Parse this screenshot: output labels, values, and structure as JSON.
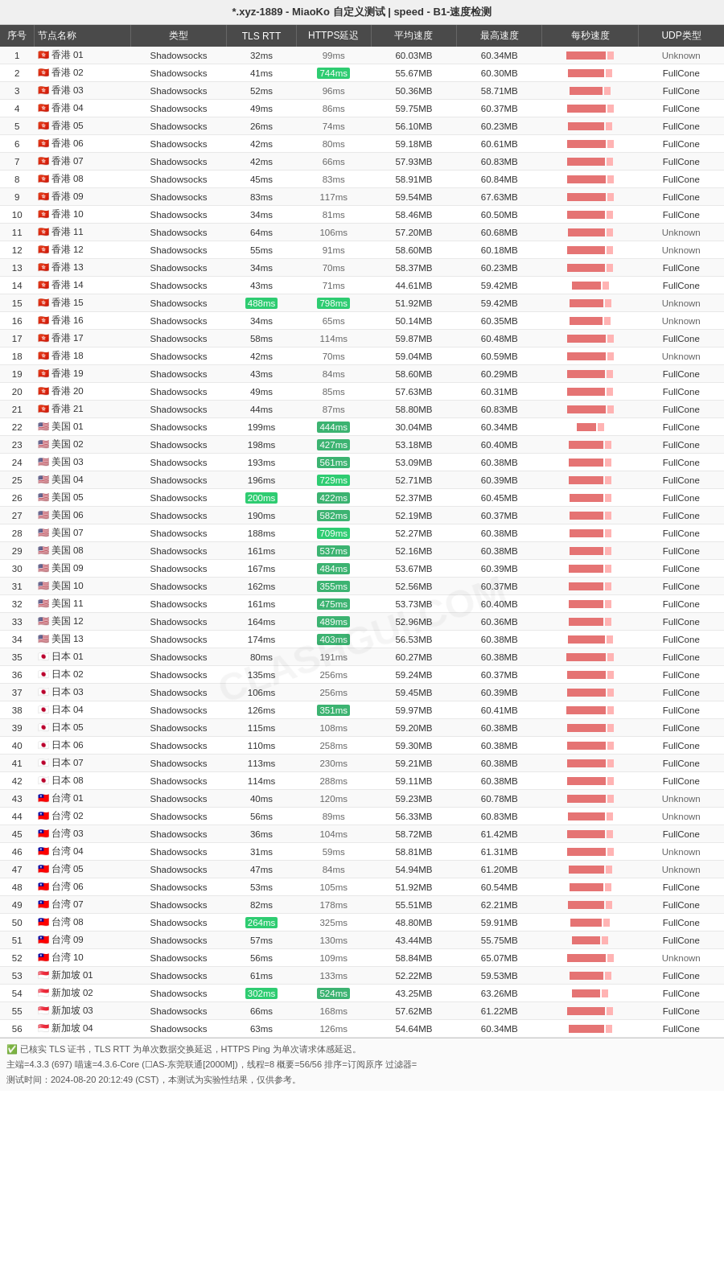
{
  "title": "*.xyz-1889 - MiaoKo 自定义测试 | speed - B1-速度检测",
  "columns": [
    "序号",
    "节点名称",
    "类型",
    "TLS RTT",
    "HTTPS延迟",
    "平均速度",
    "最高速度",
    "每秒速度",
    "UDP类型"
  ],
  "rows": [
    {
      "seq": 1,
      "name": "🇭🇰 香港 01",
      "type": "Shadowsocks",
      "tls": "32ms",
      "https": "99ms",
      "avg": "60.03MB",
      "max": "60.34MB",
      "udp": "Unknown",
      "tls_color": "normal",
      "https_color": "normal"
    },
    {
      "seq": 2,
      "name": "🇭🇰 香港 02",
      "type": "Shadowsocks",
      "tls": "41ms",
      "https": "744ms",
      "avg": "55.67MB",
      "max": "60.30MB",
      "udp": "FullCone",
      "tls_color": "normal",
      "https_color": "high"
    },
    {
      "seq": 3,
      "name": "🇭🇰 香港 03",
      "type": "Shadowsocks",
      "tls": "52ms",
      "https": "96ms",
      "avg": "50.36MB",
      "max": "58.71MB",
      "udp": "FullCone",
      "tls_color": "normal",
      "https_color": "normal"
    },
    {
      "seq": 4,
      "name": "🇭🇰 香港 04",
      "type": "Shadowsocks",
      "tls": "49ms",
      "https": "86ms",
      "avg": "59.75MB",
      "max": "60.37MB",
      "udp": "FullCone",
      "tls_color": "normal",
      "https_color": "normal"
    },
    {
      "seq": 5,
      "name": "🇭🇰 香港 05",
      "type": "Shadowsocks",
      "tls": "26ms",
      "https": "74ms",
      "avg": "56.10MB",
      "max": "60.23MB",
      "udp": "FullCone",
      "tls_color": "normal",
      "https_color": "normal"
    },
    {
      "seq": 6,
      "name": "🇭🇰 香港 06",
      "type": "Shadowsocks",
      "tls": "42ms",
      "https": "80ms",
      "avg": "59.18MB",
      "max": "60.61MB",
      "udp": "FullCone",
      "tls_color": "normal",
      "https_color": "normal"
    },
    {
      "seq": 7,
      "name": "🇭🇰 香港 07",
      "type": "Shadowsocks",
      "tls": "42ms",
      "https": "66ms",
      "avg": "57.93MB",
      "max": "60.83MB",
      "udp": "FullCone",
      "tls_color": "normal",
      "https_color": "normal"
    },
    {
      "seq": 8,
      "name": "🇭🇰 香港 08",
      "type": "Shadowsocks",
      "tls": "45ms",
      "https": "83ms",
      "avg": "58.91MB",
      "max": "60.84MB",
      "udp": "FullCone",
      "tls_color": "normal",
      "https_color": "normal"
    },
    {
      "seq": 9,
      "name": "🇭🇰 香港 09",
      "type": "Shadowsocks",
      "tls": "83ms",
      "https": "117ms",
      "avg": "59.54MB",
      "max": "67.63MB",
      "udp": "FullCone",
      "tls_color": "normal",
      "https_color": "normal"
    },
    {
      "seq": 10,
      "name": "🇭🇰 香港 10",
      "type": "Shadowsocks",
      "tls": "34ms",
      "https": "81ms",
      "avg": "58.46MB",
      "max": "60.50MB",
      "udp": "FullCone",
      "tls_color": "normal",
      "https_color": "normal"
    },
    {
      "seq": 11,
      "name": "🇭🇰 香港 11",
      "type": "Shadowsocks",
      "tls": "64ms",
      "https": "106ms",
      "avg": "57.20MB",
      "max": "60.68MB",
      "udp": "Unknown",
      "tls_color": "normal",
      "https_color": "normal"
    },
    {
      "seq": 12,
      "name": "🇭🇰 香港 12",
      "type": "Shadowsocks",
      "tls": "55ms",
      "https": "91ms",
      "avg": "58.60MB",
      "max": "60.18MB",
      "udp": "Unknown",
      "tls_color": "normal",
      "https_color": "normal"
    },
    {
      "seq": 13,
      "name": "🇭🇰 香港 13",
      "type": "Shadowsocks",
      "tls": "34ms",
      "https": "70ms",
      "avg": "58.37MB",
      "max": "60.23MB",
      "udp": "FullCone",
      "tls_color": "normal",
      "https_color": "normal"
    },
    {
      "seq": 14,
      "name": "🇭🇰 香港 14",
      "type": "Shadowsocks",
      "tls": "43ms",
      "https": "71ms",
      "avg": "44.61MB",
      "max": "59.42MB",
      "udp": "FullCone",
      "tls_color": "normal",
      "https_color": "normal"
    },
    {
      "seq": 15,
      "name": "🇭🇰 香港 15",
      "type": "Shadowsocks",
      "tls": "488ms",
      "https": "798ms",
      "avg": "51.92MB",
      "max": "59.42MB",
      "udp": "Unknown",
      "tls_color": "high",
      "https_color": "high"
    },
    {
      "seq": 16,
      "name": "🇭🇰 香港 16",
      "type": "Shadowsocks",
      "tls": "34ms",
      "https": "65ms",
      "avg": "50.14MB",
      "max": "60.35MB",
      "udp": "Unknown",
      "tls_color": "normal",
      "https_color": "normal"
    },
    {
      "seq": 17,
      "name": "🇭🇰 香港 17",
      "type": "Shadowsocks",
      "tls": "58ms",
      "https": "114ms",
      "avg": "59.87MB",
      "max": "60.48MB",
      "udp": "FullCone",
      "tls_color": "normal",
      "https_color": "normal"
    },
    {
      "seq": 18,
      "name": "🇭🇰 香港 18",
      "type": "Shadowsocks",
      "tls": "42ms",
      "https": "70ms",
      "avg": "59.04MB",
      "max": "60.59MB",
      "udp": "Unknown",
      "tls_color": "normal",
      "https_color": "normal"
    },
    {
      "seq": 19,
      "name": "🇭🇰 香港 19",
      "type": "Shadowsocks",
      "tls": "43ms",
      "https": "84ms",
      "avg": "58.60MB",
      "max": "60.29MB",
      "udp": "FullCone",
      "tls_color": "normal",
      "https_color": "normal"
    },
    {
      "seq": 20,
      "name": "🇭🇰 香港 20",
      "type": "Shadowsocks",
      "tls": "49ms",
      "https": "85ms",
      "avg": "57.63MB",
      "max": "60.31MB",
      "udp": "FullCone",
      "tls_color": "normal",
      "https_color": "normal"
    },
    {
      "seq": 21,
      "name": "🇭🇰 香港 21",
      "type": "Shadowsocks",
      "tls": "44ms",
      "https": "87ms",
      "avg": "58.80MB",
      "max": "60.83MB",
      "udp": "FullCone",
      "tls_color": "normal",
      "https_color": "normal"
    },
    {
      "seq": 22,
      "name": "🇺🇸 美国 01",
      "type": "Shadowsocks",
      "tls": "199ms",
      "https": "444ms",
      "avg": "30.04MB",
      "max": "60.34MB",
      "udp": "FullCone",
      "tls_color": "normal",
      "https_color": "medium"
    },
    {
      "seq": 23,
      "name": "🇺🇸 美国 02",
      "type": "Shadowsocks",
      "tls": "198ms",
      "https": "427ms",
      "avg": "53.18MB",
      "max": "60.40MB",
      "udp": "FullCone",
      "tls_color": "normal",
      "https_color": "medium"
    },
    {
      "seq": 24,
      "name": "🇺🇸 美国 03",
      "type": "Shadowsocks",
      "tls": "193ms",
      "https": "561ms",
      "avg": "53.09MB",
      "max": "60.38MB",
      "udp": "FullCone",
      "tls_color": "normal",
      "https_color": "medium"
    },
    {
      "seq": 25,
      "name": "🇺🇸 美国 04",
      "type": "Shadowsocks",
      "tls": "196ms",
      "https": "729ms",
      "avg": "52.71MB",
      "max": "60.39MB",
      "udp": "FullCone",
      "tls_color": "normal",
      "https_color": "high"
    },
    {
      "seq": 26,
      "name": "🇺🇸 美国 05",
      "type": "Shadowsocks",
      "tls": "200ms",
      "https": "422ms",
      "avg": "52.37MB",
      "max": "60.45MB",
      "udp": "FullCone",
      "tls_color": "normal",
      "https_color": "medium"
    },
    {
      "seq": 27,
      "name": "🇺🇸 美国 06",
      "type": "Shadowsocks",
      "tls": "190ms",
      "https": "582ms",
      "avg": "52.19MB",
      "max": "60.37MB",
      "udp": "FullCone",
      "tls_color": "normal",
      "https_color": "medium"
    },
    {
      "seq": 28,
      "name": "🇺🇸 美国 07",
      "type": "Shadowsocks",
      "tls": "188ms",
      "https": "709ms",
      "avg": "52.27MB",
      "max": "60.38MB",
      "udp": "FullCone",
      "tls_color": "normal",
      "https_color": "high"
    },
    {
      "seq": 29,
      "name": "🇺🇸 美国 08",
      "type": "Shadowsocks",
      "tls": "161ms",
      "https": "537ms",
      "avg": "52.16MB",
      "max": "60.38MB",
      "udp": "FullCone",
      "tls_color": "normal",
      "https_color": "medium"
    },
    {
      "seq": 30,
      "name": "🇺🇸 美国 09",
      "type": "Shadowsocks",
      "tls": "167ms",
      "https": "484ms",
      "avg": "53.67MB",
      "max": "60.39MB",
      "udp": "FullCone",
      "tls_color": "normal",
      "https_color": "medium"
    },
    {
      "seq": 31,
      "name": "🇺🇸 美国 10",
      "type": "Shadowsocks",
      "tls": "162ms",
      "https": "355ms",
      "avg": "52.56MB",
      "max": "60.37MB",
      "udp": "FullCone",
      "tls_color": "normal",
      "https_color": "normal"
    },
    {
      "seq": 32,
      "name": "🇺🇸 美国 11",
      "type": "Shadowsocks",
      "tls": "161ms",
      "https": "475ms",
      "avg": "53.73MB",
      "max": "60.40MB",
      "udp": "FullCone",
      "tls_color": "normal",
      "https_color": "medium"
    },
    {
      "seq": 33,
      "name": "🇺🇸 美国 12",
      "type": "Shadowsocks",
      "tls": "164ms",
      "https": "489ms",
      "avg": "52.96MB",
      "max": "60.36MB",
      "udp": "FullCone",
      "tls_color": "normal",
      "https_color": "medium"
    },
    {
      "seq": 34,
      "name": "🇺🇸 美国 13",
      "type": "Shadowsocks",
      "tls": "174ms",
      "https": "403ms",
      "avg": "56.53MB",
      "max": "60.38MB",
      "udp": "FullCone",
      "tls_color": "normal",
      "https_color": "medium"
    },
    {
      "seq": 35,
      "name": "🇯🇵 日本 01",
      "type": "Shadowsocks",
      "tls": "80ms",
      "https": "191ms",
      "avg": "60.27MB",
      "max": "60.38MB",
      "udp": "FullCone",
      "tls_color": "normal",
      "https_color": "normal"
    },
    {
      "seq": 36,
      "name": "🇯🇵 日本 02",
      "type": "Shadowsocks",
      "tls": "135ms",
      "https": "256ms",
      "avg": "59.24MB",
      "max": "60.37MB",
      "udp": "FullCone",
      "tls_color": "normal",
      "https_color": "normal"
    },
    {
      "seq": 37,
      "name": "🇯🇵 日本 03",
      "type": "Shadowsocks",
      "tls": "106ms",
      "https": "256ms",
      "avg": "59.45MB",
      "max": "60.39MB",
      "udp": "FullCone",
      "tls_color": "normal",
      "https_color": "normal"
    },
    {
      "seq": 38,
      "name": "🇯🇵 日本 04",
      "type": "Shadowsocks",
      "tls": "126ms",
      "https": "351ms",
      "avg": "59.97MB",
      "max": "60.41MB",
      "udp": "FullCone",
      "tls_color": "normal",
      "https_color": "normal"
    },
    {
      "seq": 39,
      "name": "🇯🇵 日本 05",
      "type": "Shadowsocks",
      "tls": "115ms",
      "https": "108ms",
      "avg": "59.20MB",
      "max": "60.38MB",
      "udp": "FullCone",
      "tls_color": "normal",
      "https_color": "normal"
    },
    {
      "seq": 40,
      "name": "🇯🇵 日本 06",
      "type": "Shadowsocks",
      "tls": "110ms",
      "https": "258ms",
      "avg": "59.30MB",
      "max": "60.38MB",
      "udp": "FullCone",
      "tls_color": "normal",
      "https_color": "normal"
    },
    {
      "seq": 41,
      "name": "🇯🇵 日本 07",
      "type": "Shadowsocks",
      "tls": "113ms",
      "https": "230ms",
      "avg": "59.21MB",
      "max": "60.38MB",
      "udp": "FullCone",
      "tls_color": "normal",
      "https_color": "normal"
    },
    {
      "seq": 42,
      "name": "🇯🇵 日本 08",
      "type": "Shadowsocks",
      "tls": "114ms",
      "https": "288ms",
      "avg": "59.11MB",
      "max": "60.38MB",
      "udp": "FullCone",
      "tls_color": "normal",
      "https_color": "normal"
    },
    {
      "seq": 43,
      "name": "🇹🇼 台湾 01",
      "type": "Shadowsocks",
      "tls": "40ms",
      "https": "120ms",
      "avg": "59.23MB",
      "max": "60.78MB",
      "udp": "Unknown",
      "tls_color": "normal",
      "https_color": "normal"
    },
    {
      "seq": 44,
      "name": "🇹🇼 台湾 02",
      "type": "Shadowsocks",
      "tls": "56ms",
      "https": "89ms",
      "avg": "56.33MB",
      "max": "60.83MB",
      "udp": "Unknown",
      "tls_color": "normal",
      "https_color": "normal"
    },
    {
      "seq": 45,
      "name": "🇹🇼 台湾 03",
      "type": "Shadowsocks",
      "tls": "36ms",
      "https": "104ms",
      "avg": "58.72MB",
      "max": "61.42MB",
      "udp": "FullCone",
      "tls_color": "normal",
      "https_color": "normal"
    },
    {
      "seq": 46,
      "name": "🇹🇼 台湾 04",
      "type": "Shadowsocks",
      "tls": "31ms",
      "https": "59ms",
      "avg": "58.81MB",
      "max": "61.31MB",
      "udp": "Unknown",
      "tls_color": "normal",
      "https_color": "normal"
    },
    {
      "seq": 47,
      "name": "🇹🇼 台湾 05",
      "type": "Shadowsocks",
      "tls": "47ms",
      "https": "84ms",
      "avg": "54.94MB",
      "max": "61.20MB",
      "udp": "Unknown",
      "tls_color": "normal",
      "https_color": "normal"
    },
    {
      "seq": 48,
      "name": "🇹🇼 台湾 06",
      "type": "Shadowsocks",
      "tls": "53ms",
      "https": "105ms",
      "avg": "51.92MB",
      "max": "60.54MB",
      "udp": "FullCone",
      "tls_color": "normal",
      "https_color": "normal"
    },
    {
      "seq": 49,
      "name": "🇹🇼 台湾 07",
      "type": "Shadowsocks",
      "tls": "82ms",
      "https": "178ms",
      "avg": "55.51MB",
      "max": "62.21MB",
      "udp": "FullCone",
      "tls_color": "normal",
      "https_color": "normal"
    },
    {
      "seq": 50,
      "name": "🇹🇼 台湾 08",
      "type": "Shadowsocks",
      "tls": "264ms",
      "https": "325ms",
      "avg": "48.80MB",
      "max": "59.91MB",
      "udp": "FullCone",
      "tls_color": "normal",
      "https_color": "normal"
    },
    {
      "seq": 51,
      "name": "🇹🇼 台湾 09",
      "type": "Shadowsocks",
      "tls": "57ms",
      "https": "130ms",
      "avg": "43.44MB",
      "max": "55.75MB",
      "udp": "FullCone",
      "tls_color": "normal",
      "https_color": "normal"
    },
    {
      "seq": 52,
      "name": "🇹🇼 台湾 10",
      "type": "Shadowsocks",
      "tls": "56ms",
      "https": "109ms",
      "avg": "58.84MB",
      "max": "65.07MB",
      "udp": "Unknown",
      "tls_color": "normal",
      "https_color": "normal"
    },
    {
      "seq": 53,
      "name": "🇸🇬 新加坡 01",
      "type": "Shadowsocks",
      "tls": "61ms",
      "https": "133ms",
      "avg": "52.22MB",
      "max": "59.53MB",
      "udp": "FullCone",
      "tls_color": "normal",
      "https_color": "normal"
    },
    {
      "seq": 54,
      "name": "🇸🇬 新加坡 02",
      "type": "Shadowsocks",
      "tls": "302ms",
      "https": "524ms",
      "avg": "43.25MB",
      "max": "63.26MB",
      "udp": "FullCone",
      "tls_color": "normal",
      "https_color": "medium"
    },
    {
      "seq": 55,
      "name": "🇸🇬 新加坡 03",
      "type": "Shadowsocks",
      "tls": "66ms",
      "https": "168ms",
      "avg": "57.62MB",
      "max": "61.22MB",
      "udp": "FullCone",
      "tls_color": "normal",
      "https_color": "normal"
    },
    {
      "seq": 56,
      "name": "🇸🇬 新加坡 04",
      "type": "Shadowsocks",
      "tls": "63ms",
      "https": "126ms",
      "avg": "54.64MB",
      "max": "60.34MB",
      "udp": "FullCone",
      "tls_color": "normal",
      "https_color": "normal"
    }
  ],
  "footer": {
    "note": "✅ 已核实 TLS 证书，TLS RTT 为单次数据交换延迟，HTTPS Ping 为单次请求体感延迟。",
    "info": "主端=4.3.3 (697) 喵速=4.3.6-Core (☐AS-东莞联通[2000M])，线程=8 概要=56/56 排序=订阅原序 过滤器=",
    "time": "测试时间：2024-08-20 20:12:49 (CST)，本测试为实验性结果，仅供参考。"
  },
  "watermark": "CLASHGUI.COM"
}
